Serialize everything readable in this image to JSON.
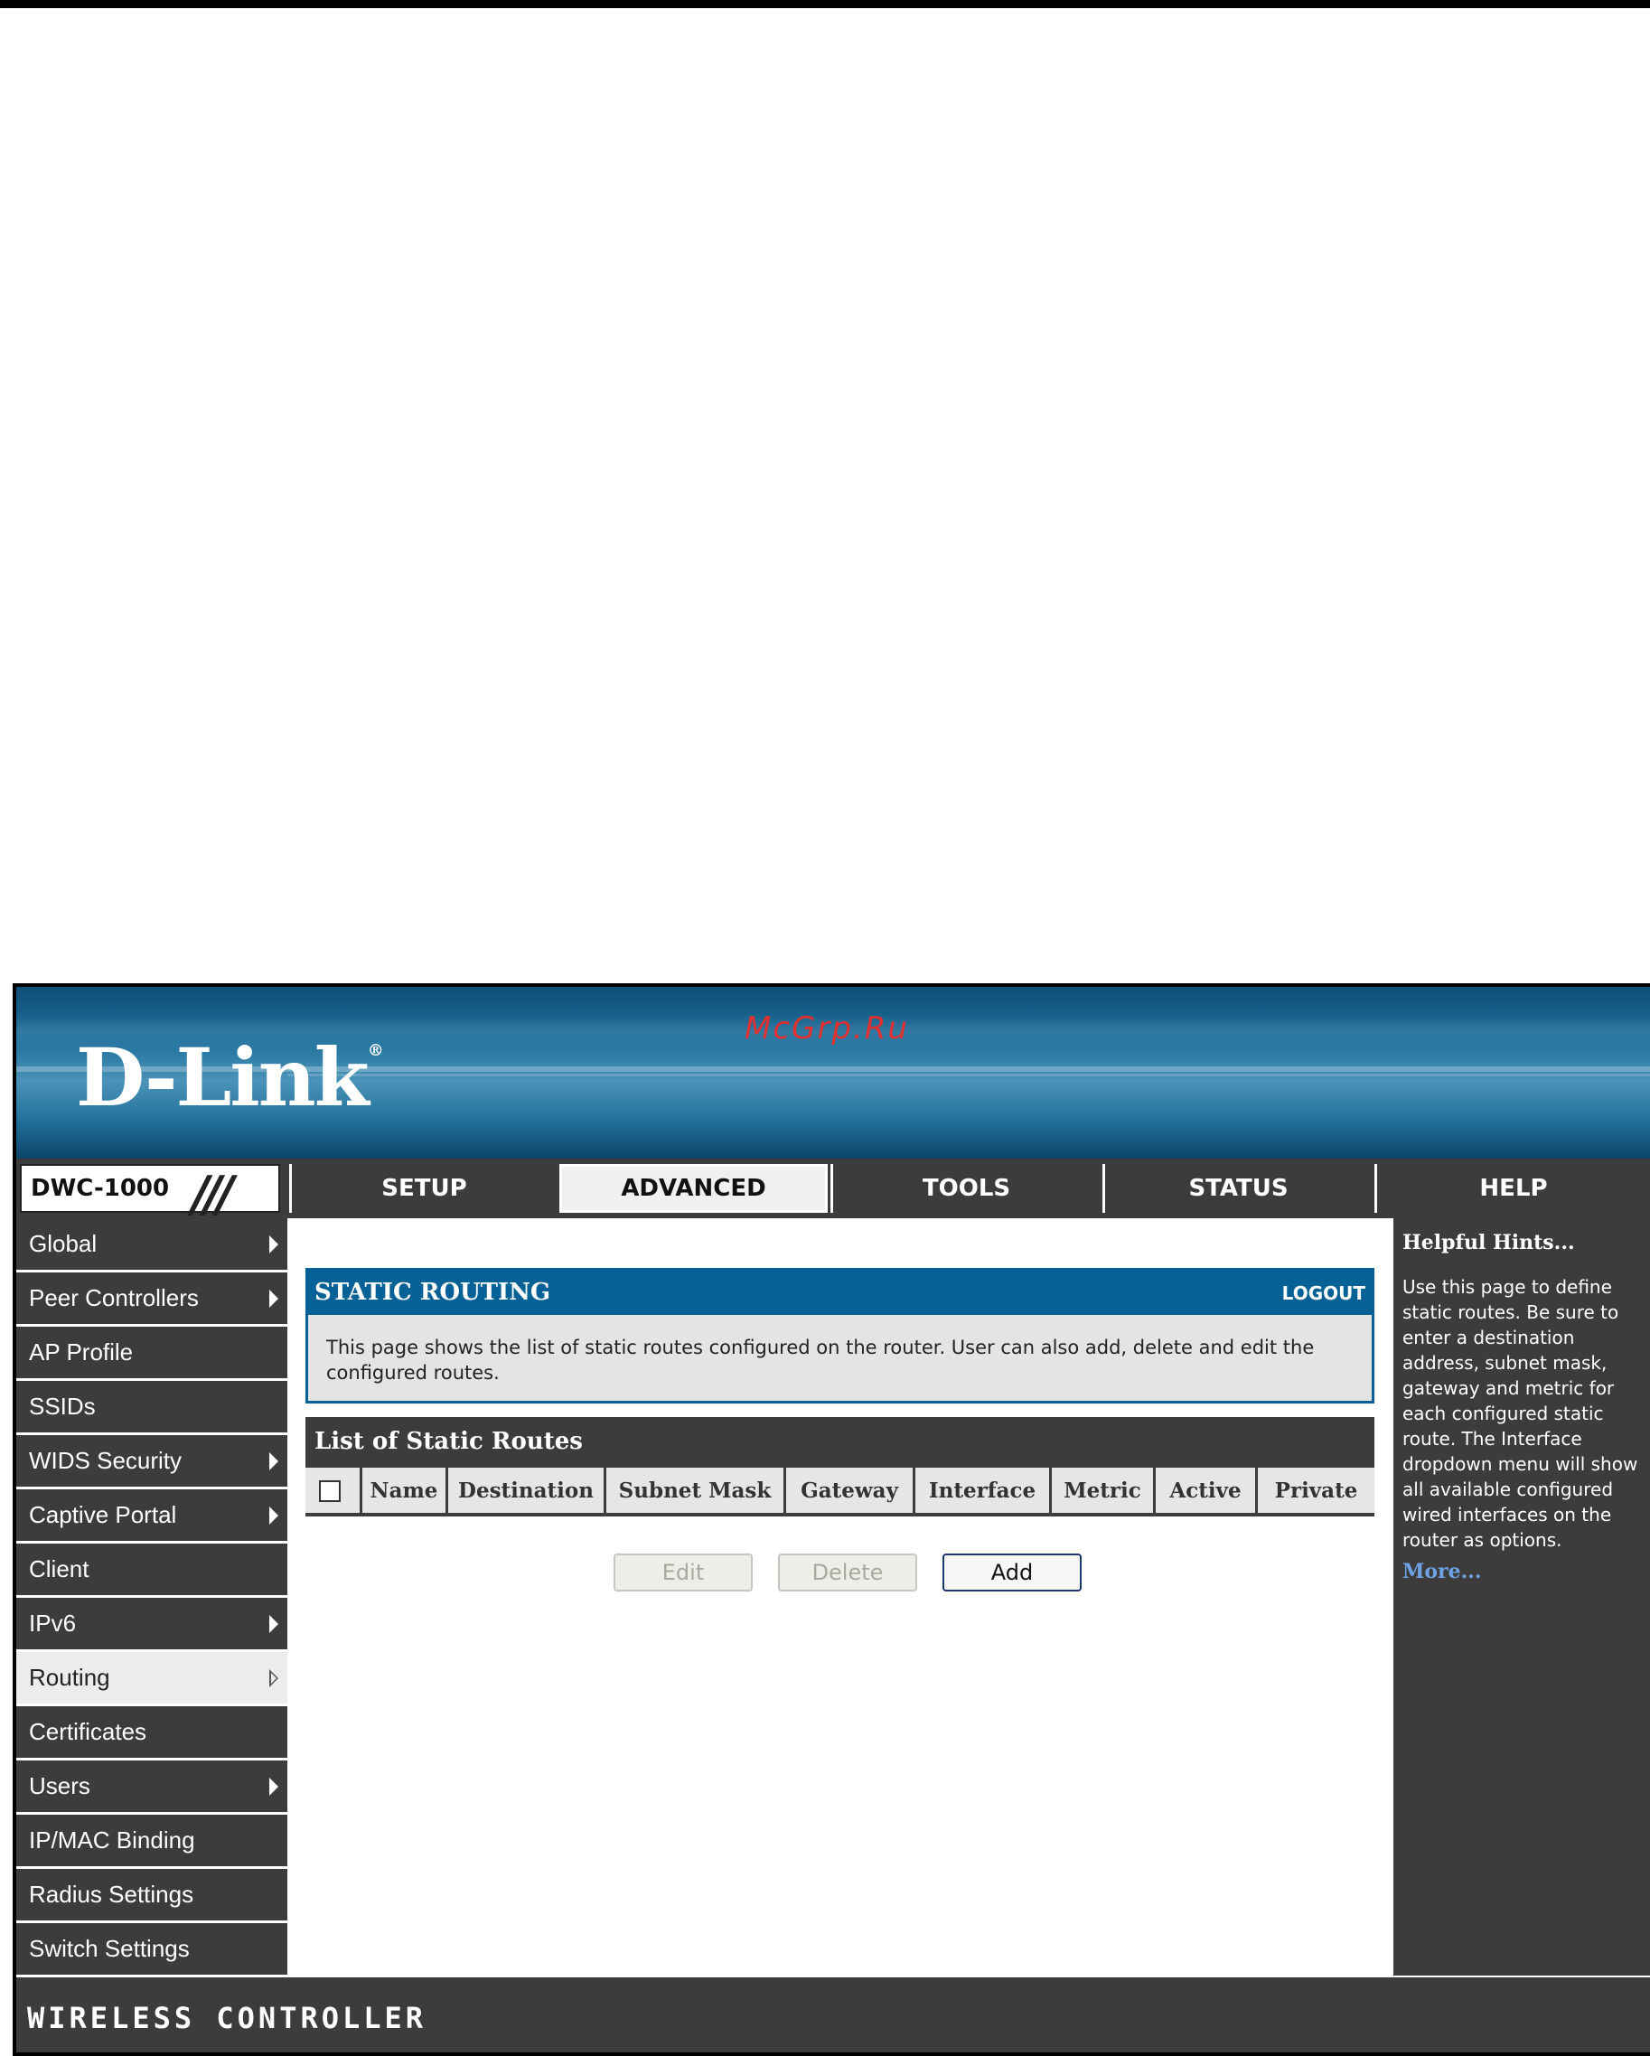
{
  "brand": {
    "logo_text": "D-Link",
    "watermark": "McGrp.Ru"
  },
  "nav": {
    "model": "DWC-1000",
    "tabs": [
      {
        "label": "SETUP",
        "active": false
      },
      {
        "label": "ADVANCED",
        "active": true
      },
      {
        "label": "TOOLS",
        "active": false
      },
      {
        "label": "STATUS",
        "active": false
      },
      {
        "label": "HELP",
        "active": false
      }
    ]
  },
  "sidebar": {
    "items": [
      {
        "label": "Global",
        "has_submenu": true
      },
      {
        "label": "Peer Controllers",
        "has_submenu": true
      },
      {
        "label": "AP Profile",
        "has_submenu": false
      },
      {
        "label": "SSIDs",
        "has_submenu": false
      },
      {
        "label": "WIDS Security",
        "has_submenu": true
      },
      {
        "label": "Captive Portal",
        "has_submenu": true
      },
      {
        "label": "Client",
        "has_submenu": false
      },
      {
        "label": "IPv6",
        "has_submenu": true
      },
      {
        "label": "Routing",
        "has_submenu": true,
        "selected": true
      },
      {
        "label": "Certificates",
        "has_submenu": false
      },
      {
        "label": "Users",
        "has_submenu": true
      },
      {
        "label": "IP/MAC Binding",
        "has_submenu": false
      },
      {
        "label": "Radius Settings",
        "has_submenu": false
      },
      {
        "label": "Switch Settings",
        "has_submenu": false
      }
    ]
  },
  "main": {
    "panel_title": "STATIC ROUTING",
    "logout": "LOGOUT",
    "description": "This page shows the list of static routes configured on the router. User can also add, delete and edit the configured routes.",
    "list_title": "List of Static Routes",
    "columns": [
      "Name",
      "Destination",
      "Subnet Mask",
      "Gateway",
      "Interface",
      "Metric",
      "Active",
      "Private"
    ],
    "buttons": {
      "edit": "Edit",
      "delete": "Delete",
      "add": "Add"
    }
  },
  "help": {
    "title": "Helpful Hints...",
    "text": "Use this page to define static routes. Be sure to enter a destination address, subnet mask, gateway and metric for each configured static route. The Interface dropdown menu will show all available configured wired interfaces on the router as options.",
    "more": "More..."
  },
  "footer": {
    "text": "WIRELESS CONTROLLER"
  },
  "colors": {
    "accent": "#066296",
    "dark": "#3c3c3c",
    "link": "#6fa3e6"
  }
}
